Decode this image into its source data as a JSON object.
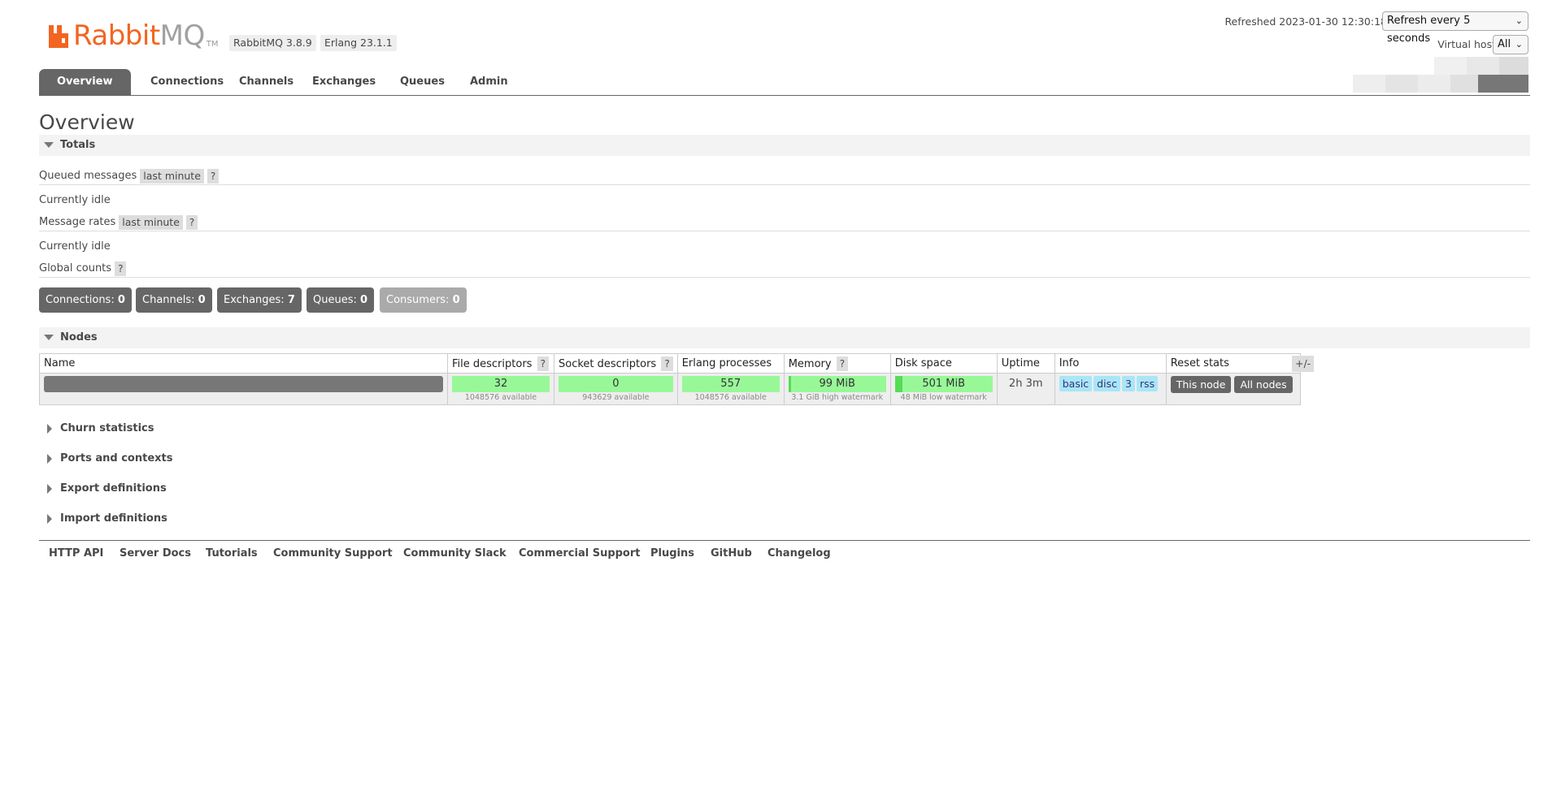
{
  "header": {
    "logo_rabbit": "Rabbit",
    "logo_mq": "MQ",
    "logo_tm": "TM",
    "version": "RabbitMQ 3.8.9",
    "erlang": "Erlang 23.1.1",
    "refreshed": "Refreshed 2023-01-30 12:30:18",
    "refresh_select": "Refresh every 5 seconds",
    "vhost_label": "Virtual host",
    "vhost_select": "All"
  },
  "tabs": [
    "Overview",
    "Connections",
    "Channels",
    "Exchanges",
    "Queues",
    "Admin"
  ],
  "page_title": "Overview",
  "totals": {
    "section_title": "Totals",
    "queued_label": "Queued messages",
    "queued_range": "last minute",
    "help": "?",
    "queued_status": "Currently idle",
    "rates_label": "Message rates",
    "rates_range": "last minute",
    "rates_status": "Currently idle",
    "global_label": "Global counts"
  },
  "counts": [
    {
      "label": "Connections:",
      "value": "0"
    },
    {
      "label": "Channels:",
      "value": "0"
    },
    {
      "label": "Exchanges:",
      "value": "7"
    },
    {
      "label": "Queues:",
      "value": "0"
    },
    {
      "label": "Consumers:",
      "value": "0"
    }
  ],
  "nodes": {
    "section_title": "Nodes",
    "columns": [
      "Name",
      "File descriptors",
      "Socket descriptors",
      "Erlang processes",
      "Memory",
      "Disk space",
      "Uptime",
      "Info",
      "Reset stats"
    ],
    "plusminus": "+/-",
    "row": {
      "file_desc": "32",
      "file_desc_sub": "1048576 available",
      "socket_desc": "0",
      "socket_desc_sub": "943629 available",
      "erlang_proc": "557",
      "erlang_proc_sub": "1048576 available",
      "memory": "99 MiB",
      "memory_sub": "3.1 GiB high watermark",
      "disk": "501 MiB",
      "disk_sub": "48 MiB low watermark",
      "uptime": "2h 3m",
      "info_tags": [
        "basic",
        "disc",
        "3",
        "rss"
      ],
      "reset_this": "This node",
      "reset_all": "All nodes"
    }
  },
  "collapsed_sections": [
    "Churn statistics",
    "Ports and contexts",
    "Export definitions",
    "Import definitions"
  ],
  "footer_links": [
    "HTTP API",
    "Server Docs",
    "Tutorials",
    "Community Support",
    "Community Slack",
    "Commercial Support",
    "Plugins",
    "GitHub",
    "Changelog"
  ],
  "colors": {
    "brand_orange": "#f26522",
    "tab_active": "#666666",
    "bar_green": "#98f898",
    "info_tag": "#a9e6f7"
  }
}
